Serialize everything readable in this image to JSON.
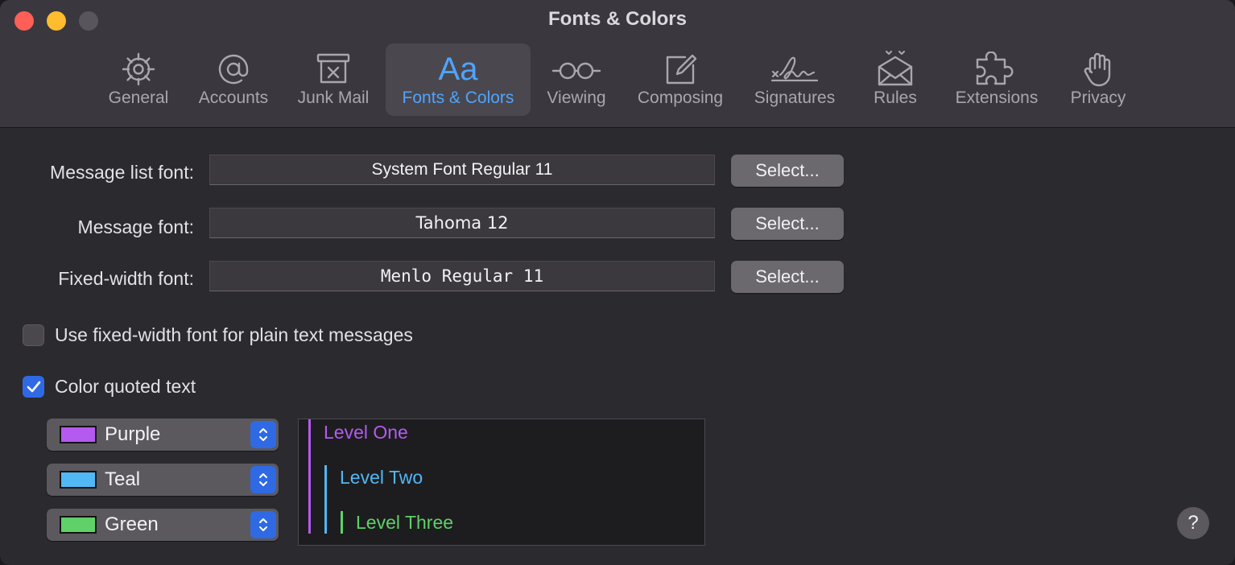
{
  "window": {
    "title": "Fonts & Colors"
  },
  "toolbar": {
    "tabs": [
      {
        "label": "General",
        "icon": "gear-icon"
      },
      {
        "label": "Accounts",
        "icon": "at-sign-icon"
      },
      {
        "label": "Junk Mail",
        "icon": "junk-mail-icon"
      },
      {
        "label": "Fonts & Colors",
        "icon": "fonts-aa-icon",
        "active": true
      },
      {
        "label": "Viewing",
        "icon": "glasses-icon"
      },
      {
        "label": "Composing",
        "icon": "compose-icon"
      },
      {
        "label": "Signatures",
        "icon": "signature-icon"
      },
      {
        "label": "Rules",
        "icon": "rules-envelope-icon"
      },
      {
        "label": "Extensions",
        "icon": "puzzle-icon"
      },
      {
        "label": "Privacy",
        "icon": "hand-icon"
      }
    ],
    "fonts_icon_text": "Aa"
  },
  "fonts": {
    "message_list": {
      "label": "Message list font:",
      "value": "System Font Regular 11",
      "button": "Select..."
    },
    "message": {
      "label": "Message font:",
      "value": "Tahoma 12",
      "button": "Select..."
    },
    "fixed_width": {
      "label": "Fixed-width font:",
      "value": "Menlo Regular 11",
      "button": "Select..."
    }
  },
  "options": {
    "use_fixed_width": {
      "label": "Use fixed-width font for plain text messages",
      "checked": false
    },
    "color_quoted": {
      "label": "Color quoted text",
      "checked": true
    }
  },
  "quote_colors": [
    {
      "name": "Purple",
      "color": "#b45af0"
    },
    {
      "name": "Teal",
      "color": "#52b7f5"
    },
    {
      "name": "Green",
      "color": "#5fd168"
    }
  ],
  "preview": {
    "levels": [
      "Level One",
      "Level Two",
      "Level Three"
    ]
  },
  "help": {
    "label": "?"
  },
  "colors": {
    "accent": "#2f6ae4",
    "active_tab_text": "#4fa4ff"
  }
}
